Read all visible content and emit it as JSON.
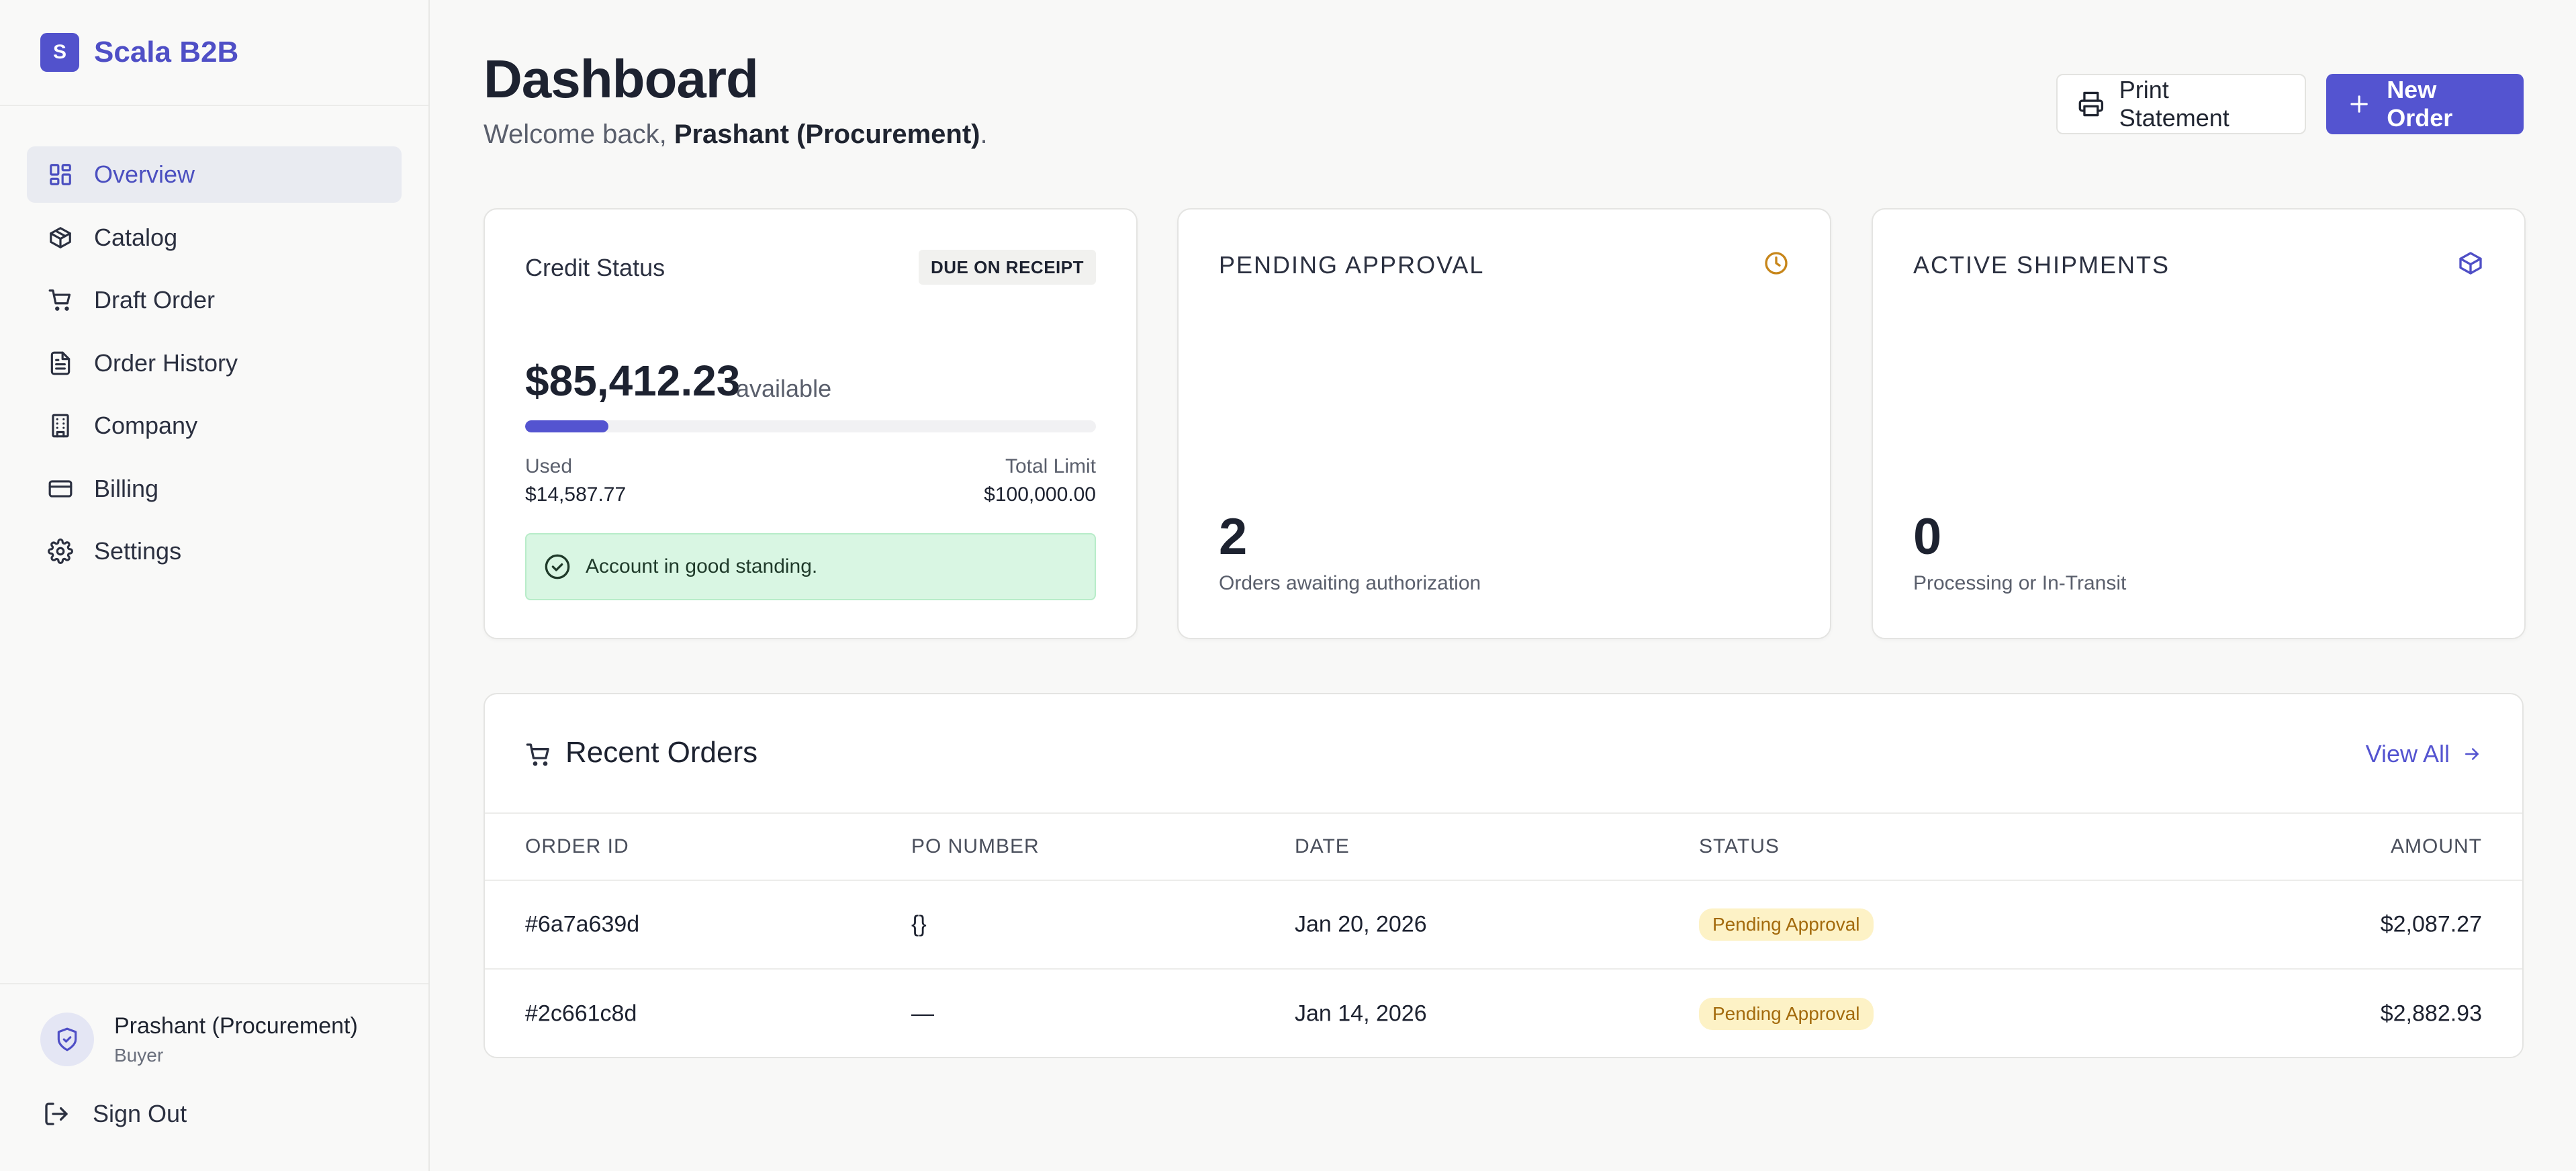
{
  "brand": {
    "logo_letter": "S",
    "name": "Scala B2B",
    "color": "#5252cc"
  },
  "nav": {
    "items": [
      {
        "label": "Overview",
        "icon": "grid-icon",
        "active": true
      },
      {
        "label": "Catalog",
        "icon": "box-icon"
      },
      {
        "label": "Draft Order",
        "icon": "cart-icon"
      },
      {
        "label": "Order History",
        "icon": "file-icon"
      },
      {
        "label": "Company",
        "icon": "building-icon"
      },
      {
        "label": "Billing",
        "icon": "credit-card-icon"
      },
      {
        "label": "Settings",
        "icon": "gear-icon"
      }
    ]
  },
  "user": {
    "name": "Prashant (Procurement)",
    "role": "Buyer",
    "sign_out": "Sign Out"
  },
  "header": {
    "title": "Dashboard",
    "welcome_prefix": "Welcome back, ",
    "welcome_name": "Prashant (Procurement)",
    "welcome_suffix": ".",
    "print_label": "Print Statement",
    "new_order_label": "New Order"
  },
  "credit": {
    "title": "Credit Status",
    "terms_badge": "DUE ON RECEIPT",
    "available_amount": "$85,412.23",
    "available_label": "available",
    "used_label": "Used",
    "used_value": "$14,587.77",
    "limit_label": "Total Limit",
    "limit_value": "$100,000.00",
    "used_fraction": 0.14588,
    "standing_text": "Account in good standing."
  },
  "pending": {
    "title": "PENDING APPROVAL",
    "value": "2",
    "subtitle": "Orders awaiting authorization",
    "icon": "clock-icon",
    "icon_color": "#c7861a"
  },
  "shipments": {
    "title": "ACTIVE SHIPMENTS",
    "value": "0",
    "subtitle": "Processing or In-Transit",
    "icon": "package-icon",
    "icon_color": "#4f4fc6"
  },
  "orders": {
    "title": "Recent Orders",
    "view_all": "View All",
    "columns": [
      "ORDER ID",
      "PO NUMBER",
      "DATE",
      "STATUS",
      "AMOUNT"
    ],
    "rows": [
      {
        "id": "#6a7a639d",
        "po": "{}",
        "date": "Jan 20, 2026",
        "status": "Pending Approval",
        "amount": "$2,087.27"
      },
      {
        "id": "#2c661c8d",
        "po": "—",
        "date": "Jan 14, 2026",
        "status": "Pending Approval",
        "amount": "$2,882.93"
      }
    ]
  }
}
